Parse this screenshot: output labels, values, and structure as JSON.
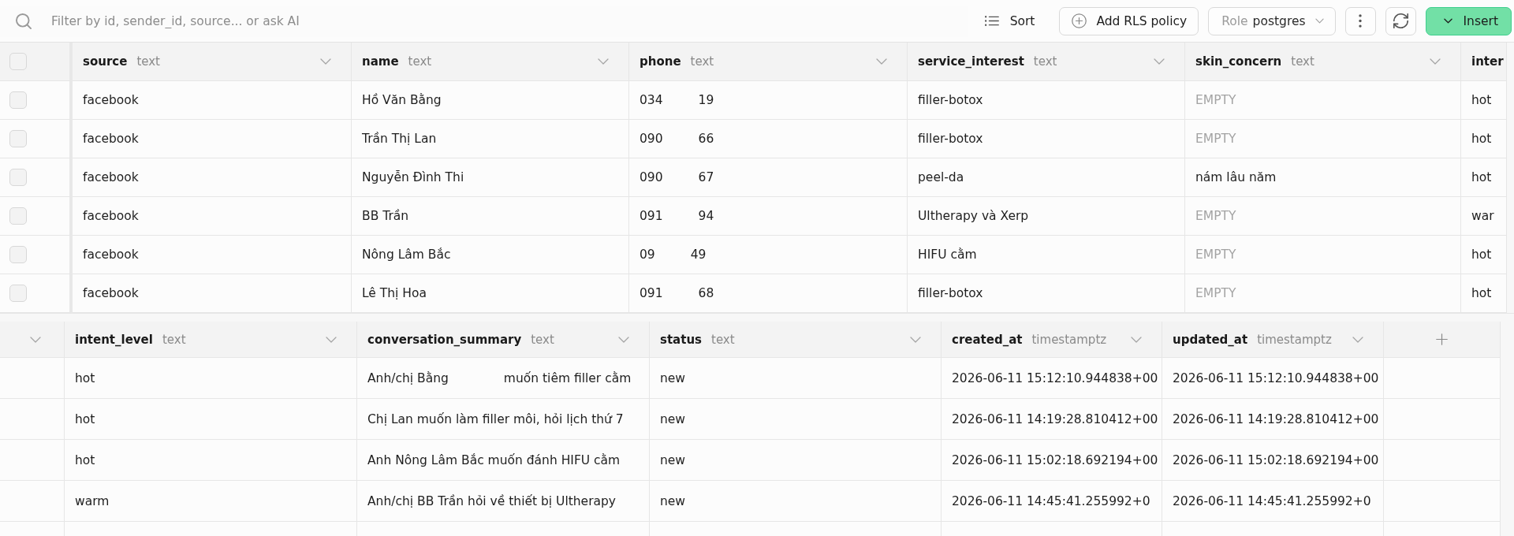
{
  "toolbar": {
    "search": {
      "placeholder": "Filter by id, sender_id, source... or ask AI"
    },
    "sort": {
      "label": "Sort"
    },
    "add_policy": {
      "label": "Add RLS policy"
    },
    "role": {
      "label": "Role",
      "value": "postgres"
    },
    "insert": {
      "label": "Insert"
    }
  },
  "table_top": {
    "select_all": {
      "checked": false
    },
    "columns": [
      {
        "kind": "field",
        "name": "source",
        "type": "text"
      },
      {
        "kind": "field",
        "name": "name",
        "type": "text"
      },
      {
        "kind": "field",
        "name": "phone",
        "type": "text"
      },
      {
        "kind": "field",
        "name": "service_interest",
        "type": "text"
      },
      {
        "kind": "field",
        "name": "skin_concern",
        "type": "text"
      },
      {
        "kind": "cut",
        "name": "inter"
      }
    ],
    "rows": [
      {
        "checked": false,
        "cells": [
          {
            "kind": "value",
            "text": "facebook"
          },
          {
            "kind": "value",
            "text": "Hồ Văn Bằng"
          },
          {
            "kind": "redacted",
            "parts": [
              "034",
              "19"
            ]
          },
          {
            "kind": "value",
            "text": "filler-botox"
          },
          {
            "kind": "null",
            "text": "EMPTY"
          },
          {
            "kind": "value",
            "text": "hot"
          }
        ]
      },
      {
        "checked": false,
        "cells": [
          {
            "kind": "value",
            "text": "facebook"
          },
          {
            "kind": "value",
            "text": "Trần Thị Lan"
          },
          {
            "kind": "redacted",
            "parts": [
              "090",
              "66"
            ]
          },
          {
            "kind": "value",
            "text": "filler-botox"
          },
          {
            "kind": "null",
            "text": "EMPTY"
          },
          {
            "kind": "value",
            "text": "hot"
          }
        ]
      },
      {
        "checked": false,
        "cells": [
          {
            "kind": "value",
            "text": "facebook"
          },
          {
            "kind": "value",
            "text": "Nguyễn Đình Thi"
          },
          {
            "kind": "redacted",
            "parts": [
              "090",
              "67"
            ]
          },
          {
            "kind": "value",
            "text": "peel-da"
          },
          {
            "kind": "value",
            "text": "nám lâu năm"
          },
          {
            "kind": "value",
            "text": "hot"
          }
        ]
      },
      {
        "checked": false,
        "cells": [
          {
            "kind": "value",
            "text": "facebook"
          },
          {
            "kind": "value",
            "text": "BB Trần"
          },
          {
            "kind": "redacted",
            "parts": [
              "091",
              "94"
            ]
          },
          {
            "kind": "value",
            "text": "Ultherapy và Xerp"
          },
          {
            "kind": "null",
            "text": "EMPTY"
          },
          {
            "kind": "value",
            "text": "war"
          }
        ]
      },
      {
        "checked": false,
        "cells": [
          {
            "kind": "value",
            "text": "facebook"
          },
          {
            "kind": "value",
            "text": "Nông Lâm Bắc"
          },
          {
            "kind": "redacted",
            "parts": [
              "09",
              "49"
            ]
          },
          {
            "kind": "value",
            "text": "HIFU cằm"
          },
          {
            "kind": "null",
            "text": "EMPTY"
          },
          {
            "kind": "value",
            "text": "hot"
          }
        ]
      },
      {
        "checked": false,
        "cells": [
          {
            "kind": "value",
            "text": "facebook"
          },
          {
            "kind": "value",
            "text": "Lê Thị Hoa"
          },
          {
            "kind": "redacted",
            "parts": [
              "091",
              "68"
            ]
          },
          {
            "kind": "value",
            "text": "filler-botox"
          },
          {
            "kind": "null",
            "text": "EMPTY"
          },
          {
            "kind": "value",
            "text": "hot"
          }
        ]
      }
    ]
  },
  "table_bottom": {
    "columns": [
      {
        "kind": "menu"
      },
      {
        "kind": "field",
        "name": "intent_level",
        "type": "text"
      },
      {
        "kind": "field",
        "name": "conversation_summary",
        "type": "text"
      },
      {
        "kind": "field",
        "name": "status",
        "type": "text"
      },
      {
        "kind": "field",
        "name": "created_at",
        "type": "timestamptz"
      },
      {
        "kind": "field",
        "name": "updated_at",
        "type": "timestamptz"
      },
      {
        "kind": "add"
      }
    ],
    "rows": [
      {
        "cells": [
          {
            "kind": "blank"
          },
          {
            "kind": "value",
            "text": "hot"
          },
          {
            "kind": "redacted",
            "parts": [
              "Anh/chị Bằng",
              "muốn tiêm filler cằm"
            ]
          },
          {
            "kind": "value",
            "text": "new"
          },
          {
            "kind": "value",
            "text": "2026-06-11 15:12:10.944838+00"
          },
          {
            "kind": "value",
            "text": "2026-06-11 15:12:10.944838+00"
          },
          {
            "kind": "blank"
          }
        ]
      },
      {
        "cells": [
          {
            "kind": "blank"
          },
          {
            "kind": "value",
            "text": "hot"
          },
          {
            "kind": "value",
            "text": "Chị Lan muốn làm filler môi, hỏi lịch thứ 7"
          },
          {
            "kind": "value",
            "text": "new"
          },
          {
            "kind": "value",
            "text": "2026-06-11 14:19:28.810412+00"
          },
          {
            "kind": "value",
            "text": "2026-06-11 14:19:28.810412+00"
          },
          {
            "kind": "blank"
          }
        ]
      },
      {
        "cells": [
          {
            "kind": "blank"
          },
          {
            "kind": "value",
            "text": "hot"
          },
          {
            "kind": "value",
            "text": "Anh Nông Lâm Bắc muốn đánh HIFU cằm"
          },
          {
            "kind": "value",
            "text": "new"
          },
          {
            "kind": "value",
            "text": "2026-06-11 15:02:18.692194+00"
          },
          {
            "kind": "value",
            "text": "2026-06-11 15:02:18.692194+00"
          },
          {
            "kind": "blank"
          }
        ]
      },
      {
        "cells": [
          {
            "kind": "blank"
          },
          {
            "kind": "value",
            "text": "warm"
          },
          {
            "kind": "value",
            "text": "Anh/chị BB Trần hỏi về thiết bị Ultherapy"
          },
          {
            "kind": "value",
            "text": "new"
          },
          {
            "kind": "value",
            "text": "2026-06-11 14:45:41.255992+0"
          },
          {
            "kind": "value",
            "text": "2026-06-11 14:45:41.255992+0"
          },
          {
            "kind": "blank"
          }
        ]
      }
    ]
  }
}
